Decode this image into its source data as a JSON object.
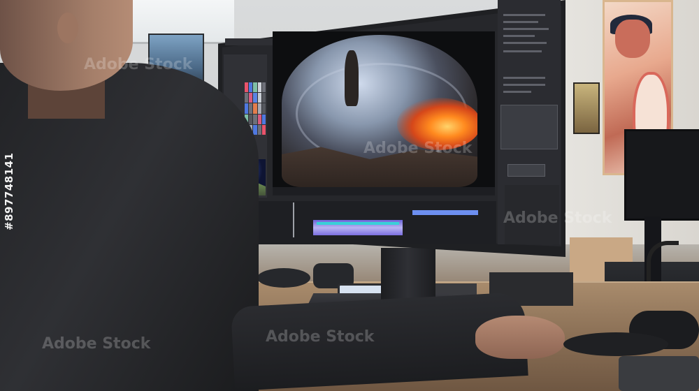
{
  "watermark": {
    "brand": "Adobe Stock",
    "stock_id": "#897748141"
  },
  "editor": {
    "title": ""
  },
  "colors": {
    "timeline_clip": "#6d8ff0",
    "timeline_clip_alt": "#b9b3f2",
    "lava": "#ff8a1f",
    "desk": "#8a6f55"
  }
}
